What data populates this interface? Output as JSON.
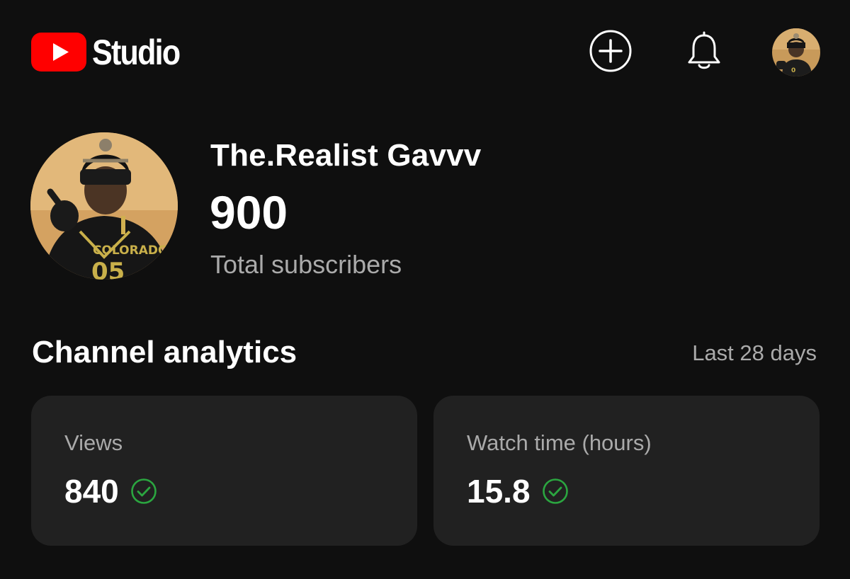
{
  "header": {
    "app_name": "Studio",
    "brand_color": "#ff0000",
    "icons": {
      "logo": "youtube-play-icon",
      "create": "plus-circle-icon",
      "notifications": "bell-icon",
      "account": "account-avatar"
    }
  },
  "channel": {
    "name": "The.Realist Gavvv",
    "subscriber_count": "900",
    "subscriber_label": "Total subscribers"
  },
  "analytics": {
    "title": "Channel analytics",
    "period": "Last 28 days",
    "cards": [
      {
        "label": "Views",
        "value": "840",
        "status_icon": "check-circle-icon"
      },
      {
        "label": "Watch time (hours)",
        "value": "15.8",
        "status_icon": "check-circle-icon"
      }
    ],
    "status_color": "#2ba640"
  }
}
